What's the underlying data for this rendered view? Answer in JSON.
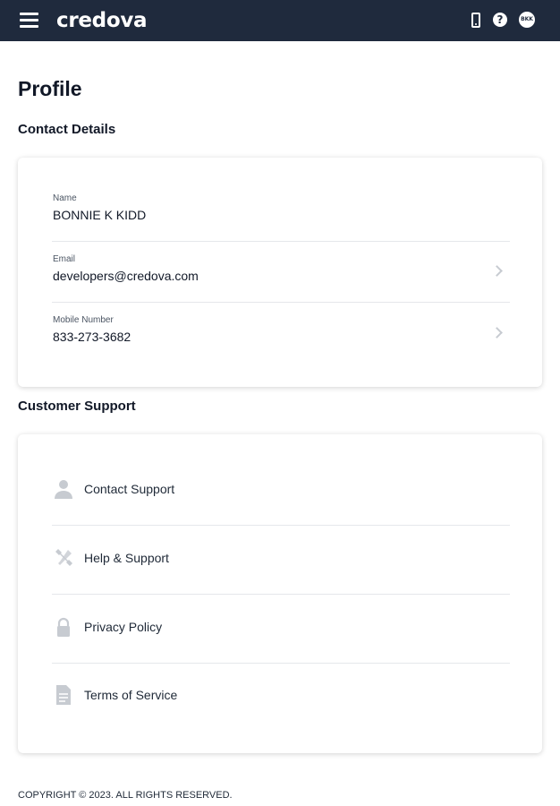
{
  "header": {
    "brand": "credova",
    "avatar_initials": "BKK"
  },
  "page": {
    "title": "Profile"
  },
  "contact_details": {
    "section_title": "Contact Details",
    "fields": [
      {
        "label": "Name",
        "value": "BONNIE K KIDD"
      },
      {
        "label": "Email",
        "value": "developers@credova.com"
      },
      {
        "label": "Mobile Number",
        "value": "833-273-3682"
      }
    ]
  },
  "customer_support": {
    "section_title": "Customer Support",
    "items": [
      {
        "label": "Contact Support",
        "icon": "person-icon"
      },
      {
        "label": "Help & Support",
        "icon": "tools-icon"
      },
      {
        "label": "Privacy Policy",
        "icon": "lock-icon"
      },
      {
        "label": "Terms of Service",
        "icon": "document-icon"
      }
    ]
  },
  "footer": {
    "copyright": "COPYRIGHT © 2023. ALL RIGHTS RESERVED."
  },
  "colors": {
    "header_bg": "#1f2a3d",
    "text_primary": "#111827",
    "divider": "#e5e7eb",
    "icon_gray": "#c7cbd1"
  }
}
